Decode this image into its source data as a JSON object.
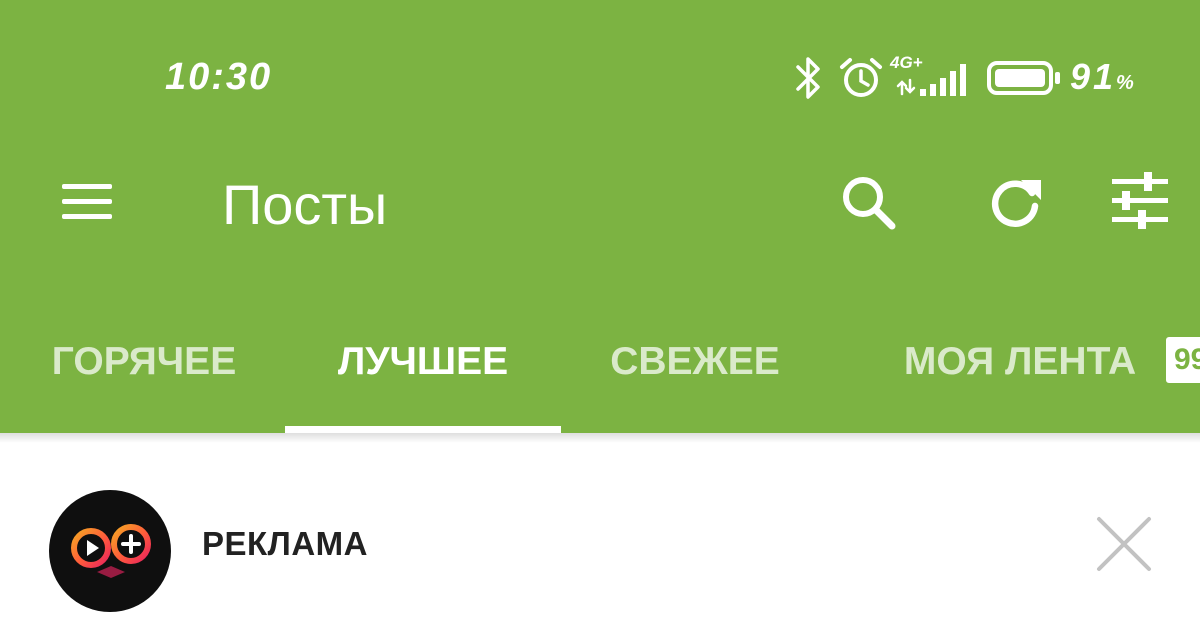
{
  "status_bar": {
    "time": "10:30",
    "network": "4G+",
    "battery_percent": "91",
    "battery_sign": "%",
    "battery_level": 0.91,
    "icons": [
      "bluetooth-icon",
      "alarm-clock-icon",
      "signal-icon",
      "battery-icon"
    ]
  },
  "toolbar": {
    "title": "Посты",
    "actions": [
      "menu-icon",
      "search-icon",
      "refresh-icon",
      "filter-sliders-icon"
    ]
  },
  "tabs": [
    {
      "label": "ГОРЯЧЕЕ",
      "active": false
    },
    {
      "label": "ЛУЧШЕЕ",
      "active": true
    },
    {
      "label": "СВЕЖЕЕ",
      "active": false
    },
    {
      "label": "МОЯ ЛЕНТА",
      "active": false
    }
  ],
  "tab_badge": "99",
  "ad": {
    "label": "РЕКЛАМА",
    "icons": [
      "advertiser-logo",
      "close-icon"
    ]
  },
  "colors": {
    "appbar": "#7cb342",
    "text_on_appbar": "#ffffff",
    "ad_label": "#222222",
    "close_icon": "#c2c2c2"
  }
}
